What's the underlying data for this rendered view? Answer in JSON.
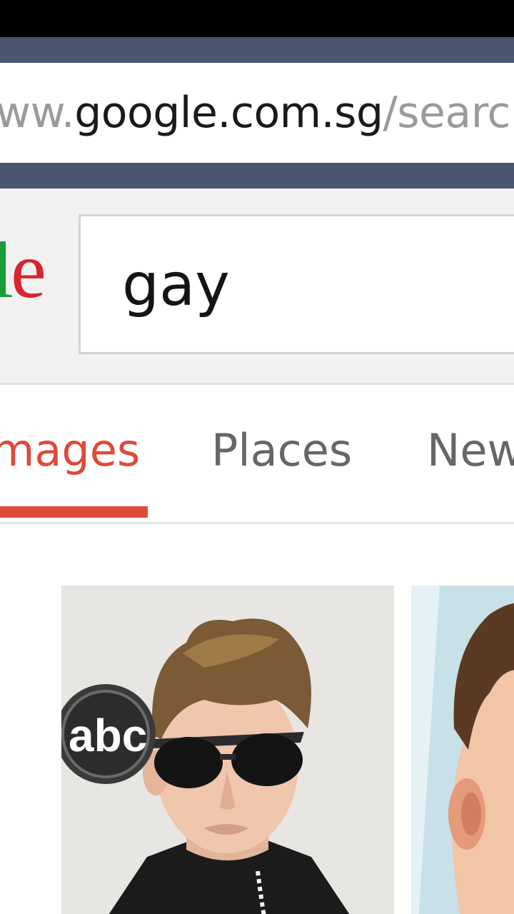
{
  "browser": {
    "url_prefix": "ww.",
    "url_host": "google.com.sg",
    "url_suffix": "/searc"
  },
  "search": {
    "logo_fragment_l": "l",
    "logo_fragment_e": "e",
    "query": "gay"
  },
  "tabs": [
    {
      "label": "mages",
      "active": true
    },
    {
      "label": "Places",
      "active": false
    },
    {
      "label": "New",
      "active": false
    }
  ],
  "colors": {
    "active_tab": "#dd4b39",
    "inactive_tab": "#666666",
    "chrome": "#4a5570"
  },
  "results": {
    "image_1_overlay_text": "abc"
  }
}
